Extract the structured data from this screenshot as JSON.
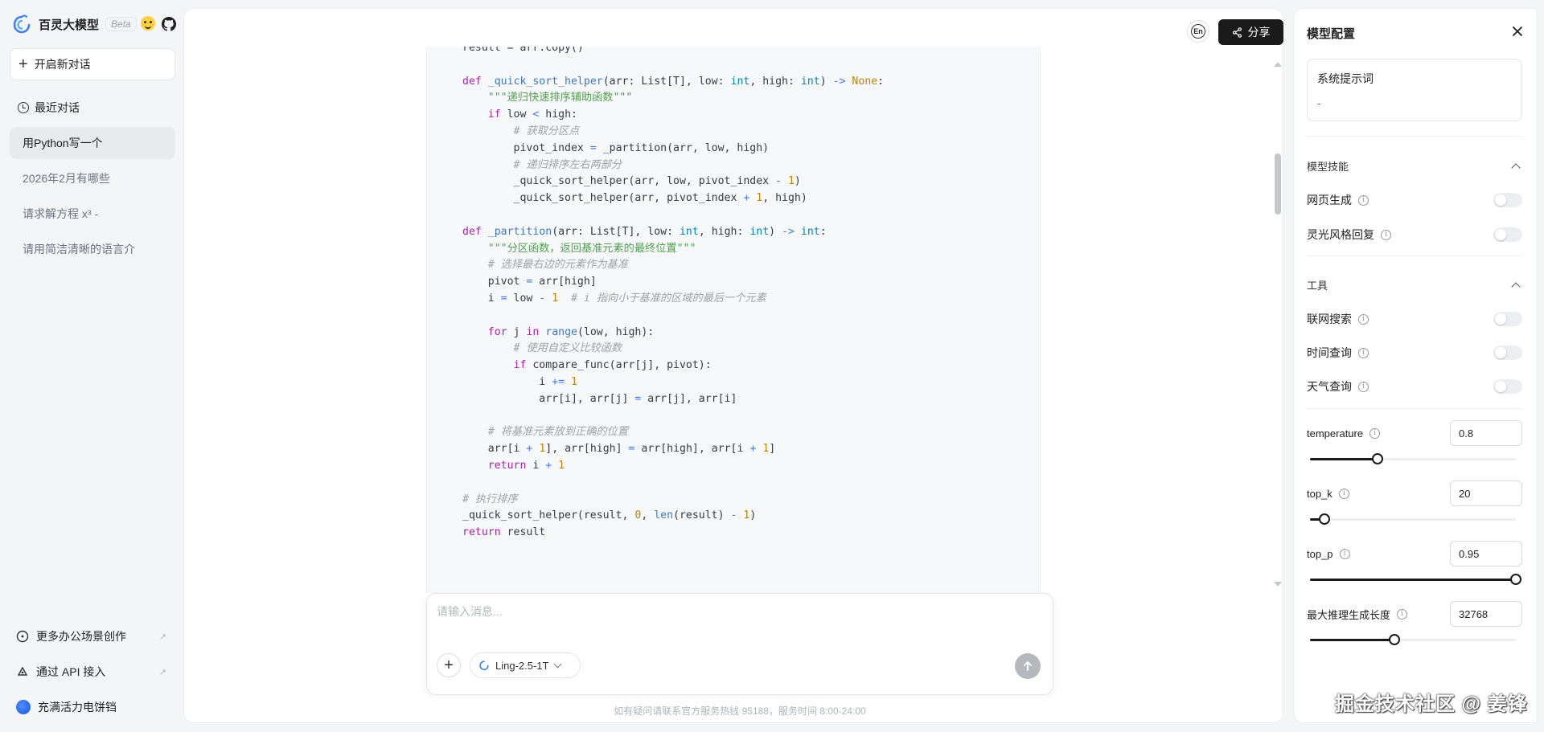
{
  "brand": {
    "name": "百灵大模型",
    "beta": "Beta"
  },
  "sidebar": {
    "new_chat": "开启新对话",
    "recent_title": "最近对话",
    "conversations": [
      {
        "label": "用Python写一个"
      },
      {
        "label": "2026年2月有哪些"
      },
      {
        "label": "请求解方程 x³ -"
      },
      {
        "label": "请用简洁清晰的语言介"
      }
    ],
    "bottom": {
      "office": "更多办公场景创作",
      "api": "通过 API 接入",
      "promo": "充满活力电饼铛"
    }
  },
  "header": {
    "lang_icon": "En",
    "share": "分享"
  },
  "input": {
    "placeholder": "请输入消息...",
    "model": "Ling-2.5-1T"
  },
  "footer_note": "如有疑问请联系官方服务热线 95188，服务时间 8:00-24:00",
  "panel": {
    "title": "模型配置",
    "system_prompt_label": "系统提示词",
    "system_prompt_value": "-",
    "skills_title": "模型技能",
    "skills": [
      {
        "label": "网页生成",
        "on": false
      },
      {
        "label": "灵光风格回复",
        "on": false
      }
    ],
    "tools_title": "工具",
    "tools": [
      {
        "label": "联网搜索",
        "on": false
      },
      {
        "label": "时间查询",
        "on": false
      },
      {
        "label": "天气查询",
        "on": false
      }
    ],
    "params": [
      {
        "label": "temperature",
        "value": "0.8",
        "level": 0.33
      },
      {
        "label": "top_k",
        "value": "20",
        "level": 0.07
      },
      {
        "label": "top_p",
        "value": "0.95",
        "level": 1.0
      },
      {
        "label": "最大推理生成长度",
        "value": "32768",
        "level": 0.41
      }
    ]
  },
  "watermark": "掘金技术社区 @ 姜锋",
  "colors": {
    "accent": "#1a1a1a",
    "code_bg": "#f7f8fa",
    "logo": "#3b82f6"
  }
}
